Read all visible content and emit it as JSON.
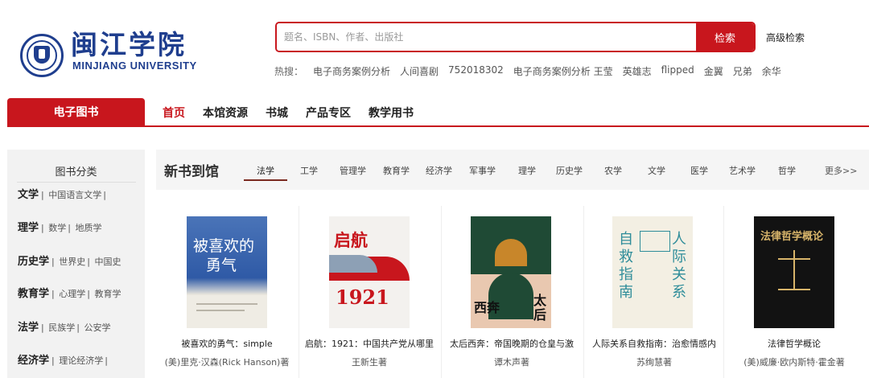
{
  "header": {
    "logo_cn": "闽江学院",
    "logo_en": "MINJIANG UNIVERSITY",
    "search_placeholder": "题名、ISBN、作者、出版社",
    "search_button": "检索",
    "advanced_search": "高级检索",
    "hot_label": "热搜：",
    "hot_keywords": [
      "电子商务案例分析",
      "人间喜剧",
      "752018302",
      "电子商务案例分析 王莹",
      "英雄志",
      "flipped",
      "金翼",
      "兄弟",
      "余华"
    ]
  },
  "nav": {
    "ebook_tab": "电子图书",
    "items": [
      "首页",
      "本馆资源",
      "书城",
      "产品专区",
      "教学用书"
    ],
    "active_index": 0
  },
  "sidebar": {
    "title": "图书分类",
    "categories": [
      {
        "main": "文学",
        "subs": [
          "中国语言文学"
        ]
      },
      {
        "main": "理学",
        "subs": [
          "数学",
          "地质学"
        ]
      },
      {
        "main": "历史学",
        "subs": [
          "世界史",
          "中国史"
        ]
      },
      {
        "main": "教育学",
        "subs": [
          "心理学",
          "教育学"
        ]
      },
      {
        "main": "法学",
        "subs": [
          "民族学",
          "公安学"
        ]
      },
      {
        "main": "经济学",
        "subs": [
          "理论经济学"
        ]
      }
    ]
  },
  "new_books": {
    "title": "新书到馆",
    "subjects": [
      "法学",
      "工学",
      "管理学",
      "教育学",
      "经济学",
      "军事学",
      "理学",
      "历史学",
      "农学",
      "文学",
      "医学",
      "艺术学",
      "哲学"
    ],
    "active_subject_index": 0,
    "more": "更多>>",
    "books": [
      {
        "title": "被喜欢的勇气：simple",
        "author": "(美)里克·汉森(Rick Hanson)著",
        "cover_text": [
          "被喜欢的",
          "勇气"
        ]
      },
      {
        "title": "启航：1921：中国共产党从哪里",
        "author": "王新生著",
        "cover_text": [
          "启航",
          "1921"
        ]
      },
      {
        "title": "太后西奔：帝国晚期的仓皇与激",
        "author": "谭木声著",
        "cover_text": [
          "西奔",
          "太后"
        ]
      },
      {
        "title": "人际关系自救指南：治愈情感内",
        "author": "苏绚慧著",
        "cover_text": [
          "自救指南",
          "人际关系"
        ]
      },
      {
        "title": "法律哲学概论",
        "author": "(美)威廉·欧内斯特·霍金著",
        "cover_text": [
          "法律哲学概论"
        ]
      }
    ]
  },
  "colors": {
    "brand_red": "#c8161d",
    "brand_blue": "#1f3e8e"
  }
}
